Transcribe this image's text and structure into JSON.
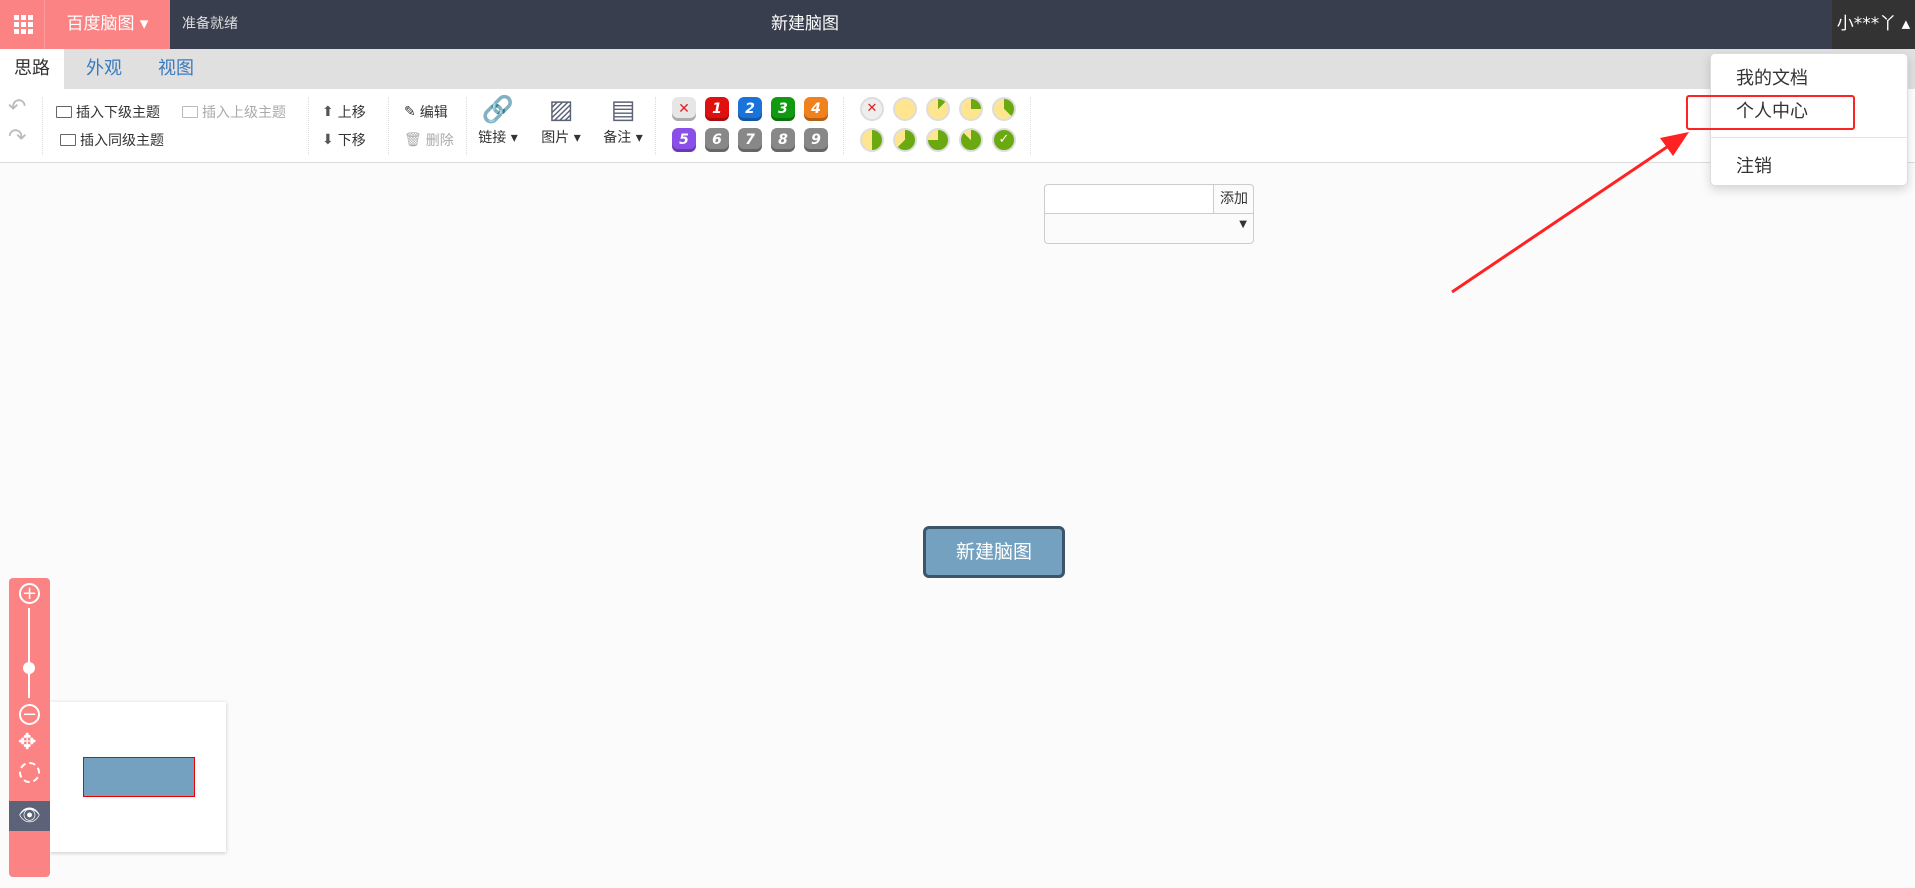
{
  "topbar": {
    "brand": "百度脑图 ▾",
    "status": "准备就绪",
    "title": "新建脑图",
    "user": "小***丫 ▴"
  },
  "tabs": [
    {
      "label": "思路",
      "active": true
    },
    {
      "label": "外观"
    },
    {
      "label": "视图"
    }
  ],
  "toolbar": {
    "insert_child": "插入下级主题",
    "insert_parent": "插入上级主题",
    "insert_sibling": "插入同级主题",
    "move_up": "上移",
    "move_down": "下移",
    "edit": "编辑",
    "delete": "删除",
    "link": "链接 ▾",
    "image": "图片 ▾",
    "note": "备注 ▾",
    "add": "添加",
    "priorities": [
      "✕",
      "1",
      "2",
      "3",
      "4",
      "5",
      "6",
      "7",
      "8",
      "9"
    ],
    "priority_colors": [
      "#e6e6e6",
      "#e01010",
      "#1a73d9",
      "#119911",
      "#f0821e",
      "#8a4fe8",
      "#888888",
      "#888888",
      "#888888",
      "#888888"
    ],
    "progress_levels": [
      "remove",
      0,
      1,
      2,
      3,
      4,
      5,
      6,
      7,
      "done"
    ]
  },
  "canvas": {
    "root_node": "新建脑图"
  },
  "dropdown": {
    "items": [
      "我的文档",
      "个人中心",
      "注销"
    ],
    "highlighted": "个人中心"
  },
  "colors": {
    "accent": "#fc8383",
    "topbar": "#393e4f",
    "node": "#73a1bf",
    "annotation": "#ff2222"
  }
}
